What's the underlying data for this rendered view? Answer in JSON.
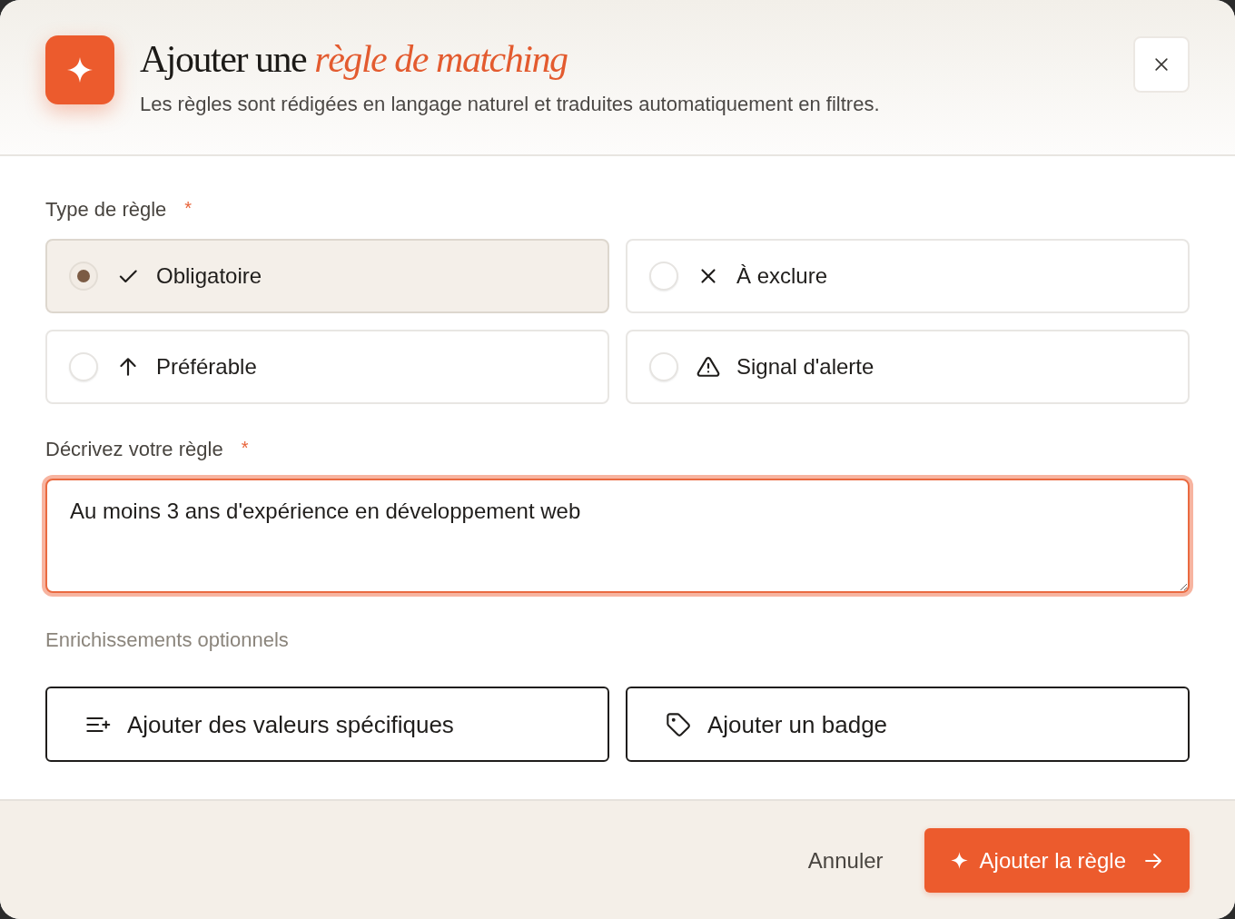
{
  "dialog": {
    "title": "Ajouter une *règle de matching*",
    "subtitle": "Les règles sont rédigées en langage naturel et traduites automatiquement en filtres."
  },
  "rule_type": {
    "label": "Type de règle",
    "required_mark": "*",
    "options": [
      {
        "label": "Obligatoire",
        "kind": "check",
        "selected": true
      },
      {
        "label": "À exclure",
        "kind": "cross",
        "selected": false
      },
      {
        "label": "Préférable",
        "kind": "arrow-up",
        "selected": false
      },
      {
        "label": "Signal d'alerte",
        "kind": "warning",
        "selected": false
      }
    ]
  },
  "description": {
    "label": "Décrivez votre règle",
    "required_mark": "*",
    "value": "Au moins 3 ans d'expérience en développement web",
    "focused": true
  },
  "enrichments": {
    "label": "Enrichissements optionnels",
    "buttons": [
      {
        "label": "Ajouter des valeurs spécifiques",
        "kind": "list-add"
      },
      {
        "label": "Ajouter un badge",
        "kind": "tag"
      }
    ]
  },
  "footer": {
    "cancel": "Annuler",
    "submit": "Ajouter la règle"
  }
}
